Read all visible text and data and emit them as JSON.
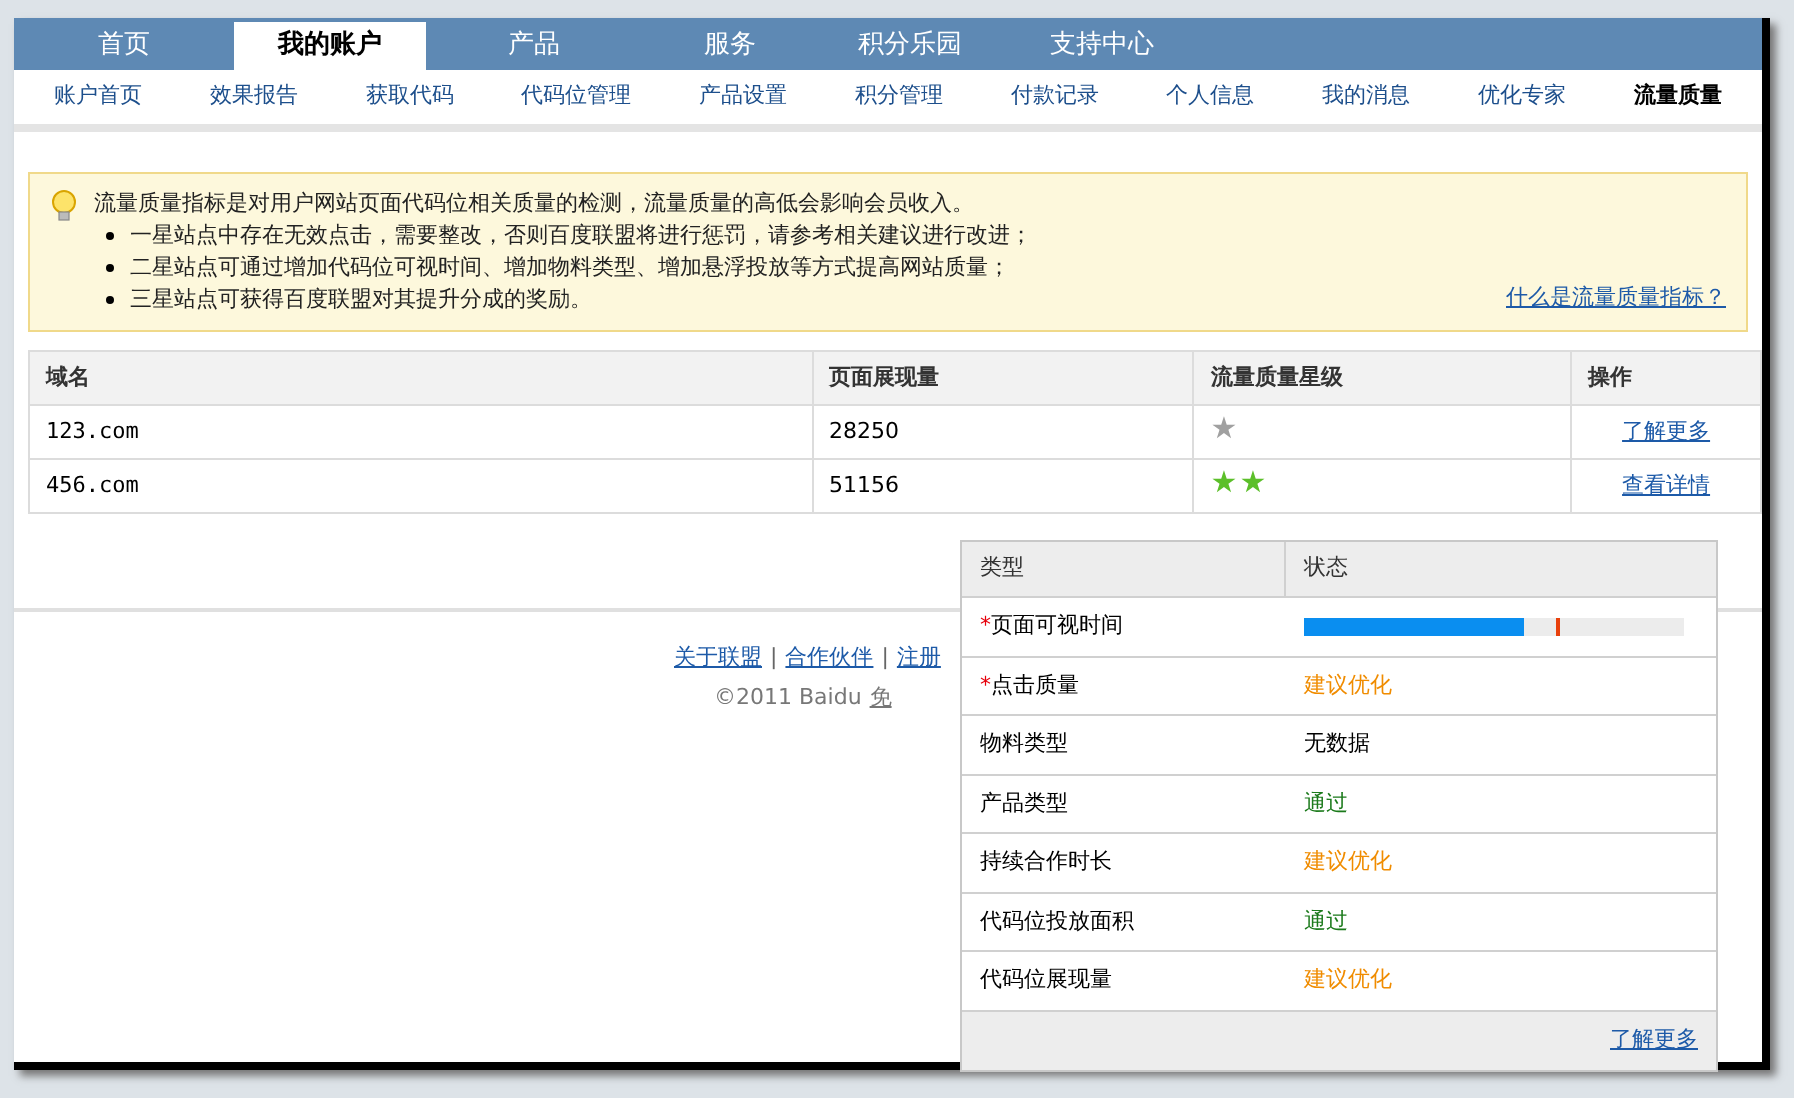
{
  "main_nav": [
    {
      "label": "首页",
      "selected": false
    },
    {
      "label": "我的账户",
      "selected": true
    },
    {
      "label": "产品",
      "selected": false
    },
    {
      "label": "服务",
      "selected": false
    },
    {
      "label": "积分乐园",
      "selected": false
    },
    {
      "label": "支持中心",
      "selected": false
    }
  ],
  "sub_nav": [
    {
      "label": "账户首页",
      "selected": false
    },
    {
      "label": "效果报告",
      "selected": false
    },
    {
      "label": "获取代码",
      "selected": false
    },
    {
      "label": "代码位管理",
      "selected": false
    },
    {
      "label": "产品设置",
      "selected": false
    },
    {
      "label": "积分管理",
      "selected": false
    },
    {
      "label": "付款记录",
      "selected": false
    },
    {
      "label": "个人信息",
      "selected": false
    },
    {
      "label": "我的消息",
      "selected": false
    },
    {
      "label": "优化专家",
      "selected": false
    },
    {
      "label": "流量质量",
      "selected": true
    }
  ],
  "notice": {
    "intro": "流量质量指标是对用户网站页面代码位相关质量的检测，流量质量的高低会影响会员收入。",
    "points": [
      "一星站点中存在无效点击，需要整改，否则百度联盟将进行惩罚，请参考相关建议进行改进；",
      "二星站点可通过增加代码位可视时间、增加物料类型、增加悬浮投放等方式提高网站质量；",
      "三星站点可获得百度联盟对其提升分成的奖励。"
    ],
    "link": "什么是流量质量指标？"
  },
  "table": {
    "columns": [
      "域名",
      "页面展现量",
      "流量质量星级",
      "操作"
    ],
    "rows": [
      {
        "domain": "123.com",
        "views": "28250",
        "rating": "★",
        "color": "#a0a0a0",
        "action": "了解更多"
      },
      {
        "domain": "456.com",
        "views": "51156",
        "rating": "★★",
        "color": "#5cbf2a",
        "action": "查看详情"
      }
    ]
  },
  "footer": {
    "links": [
      "关于联盟",
      "合作伙伴",
      "注册"
    ],
    "separator": "|",
    "copyright": "©2011 Baidu",
    "disclaimer": "免"
  },
  "popup": {
    "columns": [
      "类型",
      "状态"
    ],
    "required_mark": "*",
    "rows": [
      {
        "label": "页面可视时间",
        "required": true,
        "kind": "bar",
        "level": 0.58
      },
      {
        "label": "点击质量",
        "required": true,
        "kind": "warn",
        "status": "建议优化"
      },
      {
        "label": "物料类型",
        "required": false,
        "kind": "none",
        "status": "无数据"
      },
      {
        "label": "产品类型",
        "required": false,
        "kind": "pass",
        "status": "通过"
      },
      {
        "label": "持续合作时长",
        "required": false,
        "kind": "warn",
        "status": "建议优化"
      },
      {
        "label": "代码位投放面积",
        "required": false,
        "kind": "pass",
        "status": "通过"
      },
      {
        "label": "代码位展现量",
        "required": false,
        "kind": "warn",
        "status": "建议优化"
      }
    ],
    "link": "了解更多"
  }
}
